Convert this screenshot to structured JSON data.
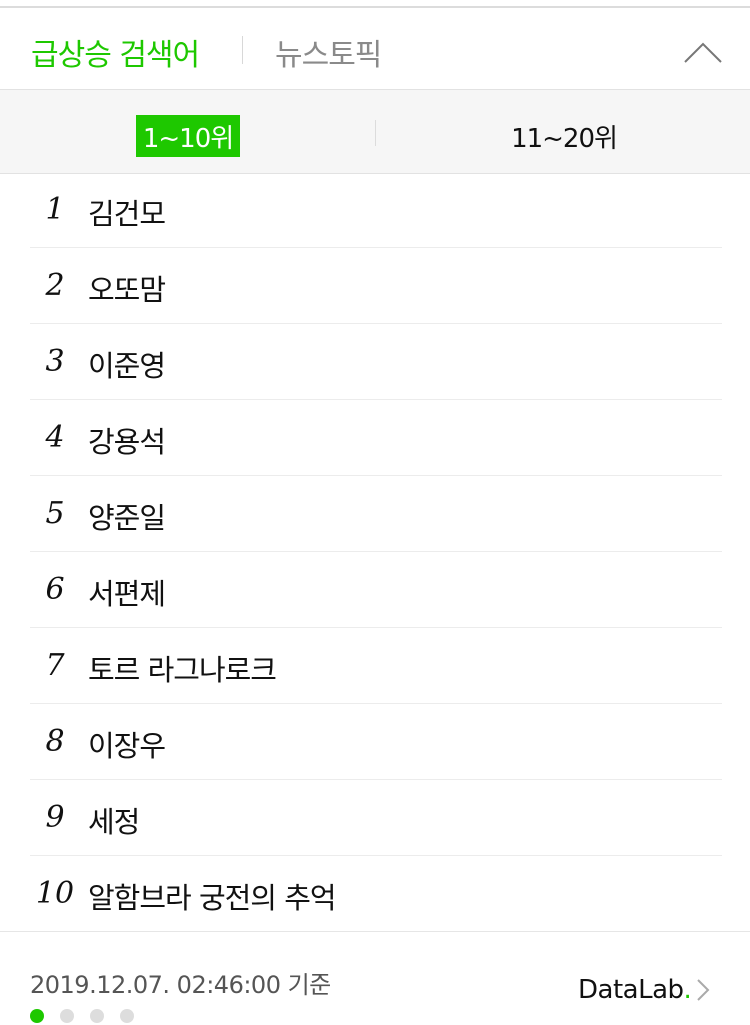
{
  "header": {
    "active_tab": "급상승 검색어",
    "inactive_tab": "뉴스토픽"
  },
  "range_tabs": {
    "active": "1~10위",
    "inactive": "11~20위"
  },
  "keywords": [
    {
      "rank": "1",
      "text": "김건모"
    },
    {
      "rank": "2",
      "text": "오또맘"
    },
    {
      "rank": "3",
      "text": "이준영"
    },
    {
      "rank": "4",
      "text": "강용석"
    },
    {
      "rank": "5",
      "text": "양준일"
    },
    {
      "rank": "6",
      "text": "서편제"
    },
    {
      "rank": "7",
      "text": "토르 라그나로크"
    },
    {
      "rank": "8",
      "text": "이장우"
    },
    {
      "rank": "9",
      "text": "세정"
    },
    {
      "rank": "10",
      "text": "알함브라 궁전의 추억"
    }
  ],
  "footer": {
    "timestamp": "2019.12.07. 02:46:00 기준",
    "datalab_text": "DataLab",
    "datalab_dot": ".",
    "page_count": 4,
    "active_page": 1
  },
  "colors": {
    "accent": "#1ec800",
    "text": "#111111",
    "muted": "#8a8a8a"
  },
  "icons": {
    "collapse": "chevron-up-icon",
    "datalab_arrow": "chevron-right-icon"
  }
}
